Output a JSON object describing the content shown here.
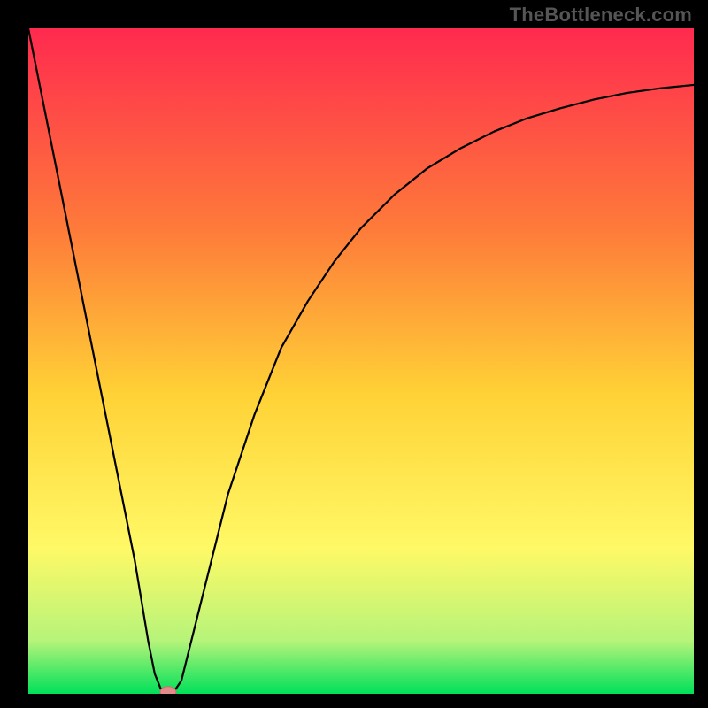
{
  "watermark": "TheBottleneck.com",
  "colors": {
    "gradient_top": "#ff2a4f",
    "gradient_mid_upper": "#fe7a3a",
    "gradient_mid": "#ffd236",
    "gradient_mid_lower": "#fff966",
    "gradient_lower": "#b6f47a",
    "gradient_bottom": "#00e05a",
    "curve": "#000000",
    "marker_fill": "#e58a8a",
    "marker_stroke": "#c96f6f",
    "frame": "#000000"
  },
  "chart_data": {
    "type": "line",
    "title": "",
    "xlabel": "",
    "ylabel": "",
    "xlim": [
      0,
      100
    ],
    "ylim": [
      0,
      100
    ],
    "grid": false,
    "x": [
      0,
      2,
      4,
      6,
      8,
      10,
      12,
      14,
      16,
      18,
      19,
      20,
      21,
      22,
      23,
      24,
      26,
      28,
      30,
      34,
      38,
      42,
      46,
      50,
      55,
      60,
      65,
      70,
      75,
      80,
      85,
      90,
      95,
      100
    ],
    "values": [
      100,
      90,
      80,
      70,
      60,
      50,
      40,
      30,
      20,
      8,
      3,
      0.5,
      0.3,
      0.5,
      2,
      6,
      14,
      22,
      30,
      42,
      52,
      59,
      65,
      70,
      75,
      79,
      82,
      84.5,
      86.5,
      88,
      89.3,
      90.3,
      91,
      91.5
    ],
    "marker": {
      "x": 21,
      "y": 0.3
    },
    "annotations": []
  }
}
